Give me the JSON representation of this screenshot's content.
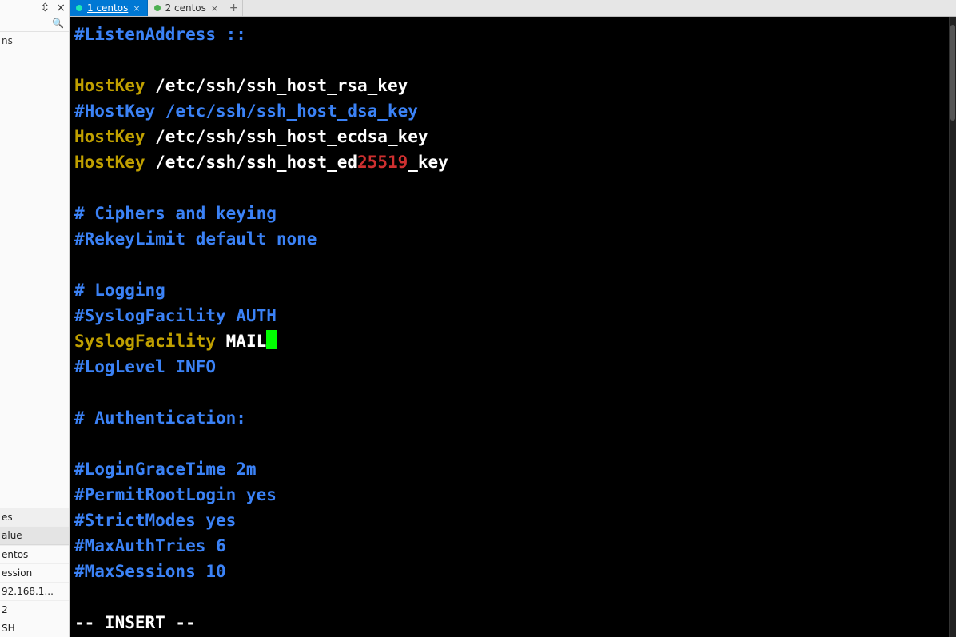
{
  "left_panel": {
    "pin_glyph": "⇳",
    "close_glyph": "×",
    "search_glyph": "🔍",
    "tree_top": "ns",
    "bottom": {
      "header1": "es",
      "header2": "alue",
      "rows": [
        "entos",
        "ession",
        "92.168.1...",
        "2",
        "SH"
      ]
    }
  },
  "tabs": {
    "items": [
      {
        "label": "1 centos",
        "active": true
      },
      {
        "label": "2 centos",
        "active": false
      }
    ],
    "add_glyph": "+",
    "close_glyph": "×"
  },
  "editor": {
    "lines": [
      [
        {
          "cls": "c-blue",
          "t": "#ListenAddress ::"
        }
      ],
      [],
      [
        {
          "cls": "c-yellow",
          "t": "HostKey"
        },
        {
          "cls": "c-white",
          "t": " /etc/ssh/ssh_host_rsa_key"
        }
      ],
      [
        {
          "cls": "c-blue",
          "t": "#HostKey /etc/ssh/ssh_host_dsa_key"
        }
      ],
      [
        {
          "cls": "c-yellow",
          "t": "HostKey"
        },
        {
          "cls": "c-white",
          "t": " /etc/ssh/ssh_host_ecdsa_key"
        }
      ],
      [
        {
          "cls": "c-yellow",
          "t": "HostKey"
        },
        {
          "cls": "c-white",
          "t": " /etc/ssh/ssh_host_ed"
        },
        {
          "cls": "c-red",
          "t": "25519"
        },
        {
          "cls": "c-white",
          "t": "_key"
        }
      ],
      [],
      [
        {
          "cls": "c-blue",
          "t": "# Ciphers and keying"
        }
      ],
      [
        {
          "cls": "c-blue",
          "t": "#RekeyLimit default none"
        }
      ],
      [],
      [
        {
          "cls": "c-blue",
          "t": "# Logging"
        }
      ],
      [
        {
          "cls": "c-blue",
          "t": "#SyslogFacility AUTH"
        }
      ],
      [
        {
          "cls": "c-yellow",
          "t": "SyslogFacility"
        },
        {
          "cls": "c-white",
          "t": " MAIL"
        },
        {
          "cls": "cursor",
          "t": ""
        }
      ],
      [
        {
          "cls": "c-blue",
          "t": "#LogLevel INFO"
        }
      ],
      [],
      [
        {
          "cls": "c-blue",
          "t": "# Authentication:"
        }
      ],
      [],
      [
        {
          "cls": "c-blue",
          "t": "#LoginGraceTime 2m"
        }
      ],
      [
        {
          "cls": "c-blue",
          "t": "#PermitRootLogin yes"
        }
      ],
      [
        {
          "cls": "c-blue",
          "t": "#StrictModes yes"
        }
      ],
      [
        {
          "cls": "c-blue",
          "t": "#MaxAuthTries 6"
        }
      ],
      [
        {
          "cls": "c-blue",
          "t": "#MaxSessions 10"
        }
      ]
    ],
    "status": "-- INSERT --"
  }
}
